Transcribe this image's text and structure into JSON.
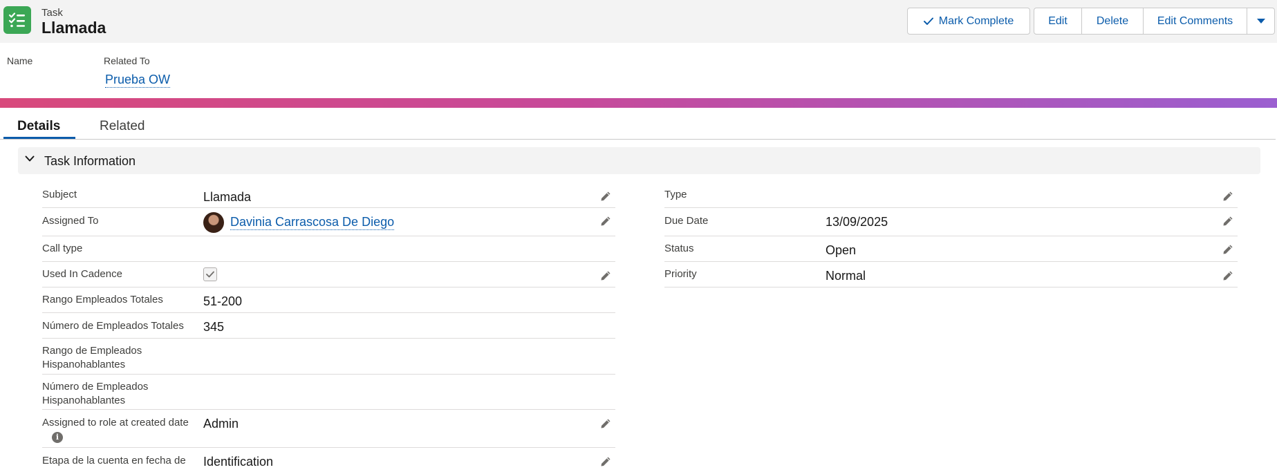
{
  "header": {
    "object_type": "Task",
    "title": "Llamada",
    "actions": {
      "mark_complete": "Mark Complete",
      "edit": "Edit",
      "delete": "Delete",
      "edit_comments": "Edit Comments"
    }
  },
  "highlights": {
    "name_label": "Name",
    "related_to_label": "Related To",
    "related_to_value": "Prueba OW"
  },
  "tabs": {
    "details": "Details",
    "related": "Related"
  },
  "section": {
    "title": "Task Information"
  },
  "left_fields": {
    "subject": {
      "label": "Subject",
      "value": "Llamada"
    },
    "assigned_to": {
      "label": "Assigned To",
      "value": "Davinia Carrascosa De Diego"
    },
    "call_type": {
      "label": "Call type",
      "value": ""
    },
    "used_in_cadence": {
      "label": "Used In Cadence",
      "checked": true
    },
    "rango_totales": {
      "label": "Rango Empleados Totales",
      "value": "51-200"
    },
    "numero_totales": {
      "label": "Número de Empleados Totales",
      "value": "345"
    },
    "rango_hispano": {
      "label_line1": "Rango de Empleados",
      "label_line2": "Hispanohablantes",
      "value": ""
    },
    "numero_hispano": {
      "label_line1": "Número de Empleados",
      "label_line2": "Hispanohablantes",
      "value": ""
    },
    "assigned_role": {
      "label": "Assigned to role at created date",
      "value": "Admin"
    },
    "etapa_cuenta": {
      "label": "Etapa de la cuenta en fecha de",
      "value": "Identification"
    }
  },
  "right_fields": {
    "type": {
      "label": "Type",
      "value": ""
    },
    "due_date": {
      "label": "Due Date",
      "value": "13/09/2025"
    },
    "status": {
      "label": "Status",
      "value": "Open"
    },
    "priority": {
      "label": "Priority",
      "value": "Normal"
    }
  },
  "colors": {
    "brand_green": "#3ba755",
    "link_blue": "#0b5cab"
  }
}
